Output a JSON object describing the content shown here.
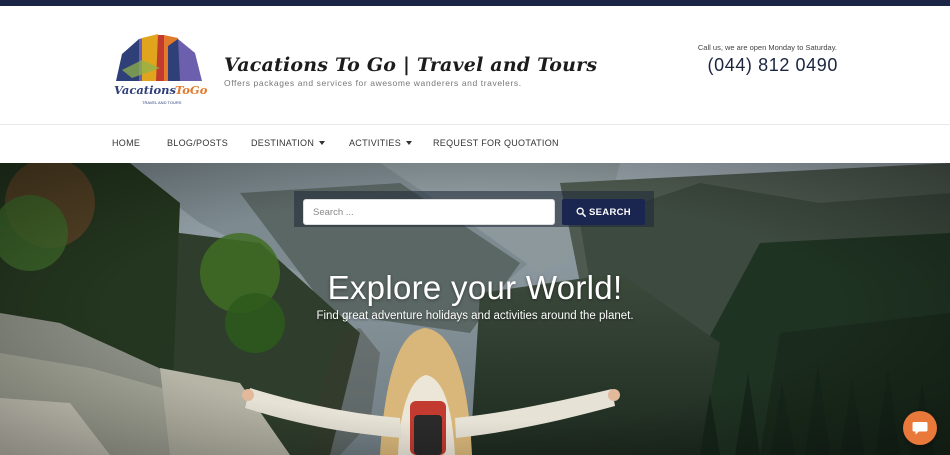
{
  "header": {
    "brand_title": "Vacations To Go | Travel and Tours",
    "tagline": "Offers packages and services for awesome wanderers and travelers.",
    "call_text": "Call us, we are open Monday to Saturday.",
    "phone": "(044) 812 0490",
    "logo": {
      "name": "vacations-to-go-logo",
      "wordmark": "Vacations To Go",
      "sub_text": "TRAVEL AND TOURS",
      "colors": [
        "#2f3f78",
        "#6b5fae",
        "#c33a2f",
        "#e0a51c",
        "#e27a2c",
        "#8fb34a"
      ]
    }
  },
  "nav": {
    "items": [
      {
        "label": "HOME",
        "dropdown": false
      },
      {
        "label": "BLOG/POSTS",
        "dropdown": false
      },
      {
        "label": "DESTINATION",
        "dropdown": true
      },
      {
        "label": "ACTIVITIES",
        "dropdown": true
      },
      {
        "label": "REQUEST FOR QUOTATION",
        "dropdown": false
      }
    ]
  },
  "hero": {
    "title": "Explore your World!",
    "subtitle": "Find great adventure holidays and activities around the planet.",
    "search_placeholder": "Search ...",
    "search_button": "SEARCH"
  },
  "icons": {
    "search_button_icon": "search-icon",
    "chat_icon": "chat-bubble-icon"
  },
  "colors": {
    "top_bar": "#1b2545",
    "phone_text": "#1a2540",
    "search_button": "#1a2550",
    "chat_button": "#e8793a"
  }
}
